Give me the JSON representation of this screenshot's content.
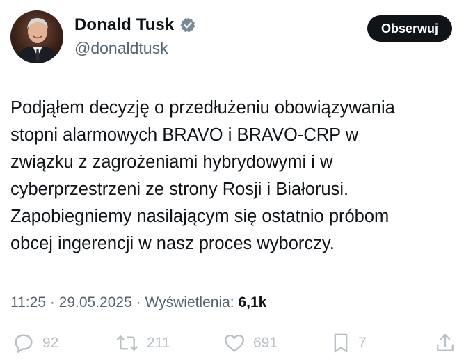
{
  "author": {
    "display_name": "Donald Tusk",
    "handle": "@donaldtusk",
    "verified": true,
    "avatar_icon": "avatar-photo"
  },
  "follow_button": {
    "label": "Obserwuj"
  },
  "tweet": {
    "lines": [
      "Podjąłem decyzję o przedłużeniu obowiązywania",
      "stopni alarmowych BRAVO i BRAVO-CRP w",
      "związku z zagrożeniami hybrydowymi i w",
      "cyberprzestrzeni ze strony Rosji i Białorusi.",
      "Zapobiegniemy nasilającym się ostatnio próbom",
      "obcej ingerencji w nasz proces wyborczy."
    ]
  },
  "meta": {
    "time": "11:25",
    "separator": " · ",
    "date": "29.05.2025",
    "views_label": "Wyświetlenia:",
    "views_count": "6,1k"
  },
  "actions": {
    "replies": "92",
    "reposts": "211",
    "likes": "691",
    "bookmarks": "7"
  },
  "colors": {
    "text": "#0f1419",
    "secondary": "#536471",
    "verified": "#7c8a96",
    "action_gray": "#b8c0c7"
  }
}
